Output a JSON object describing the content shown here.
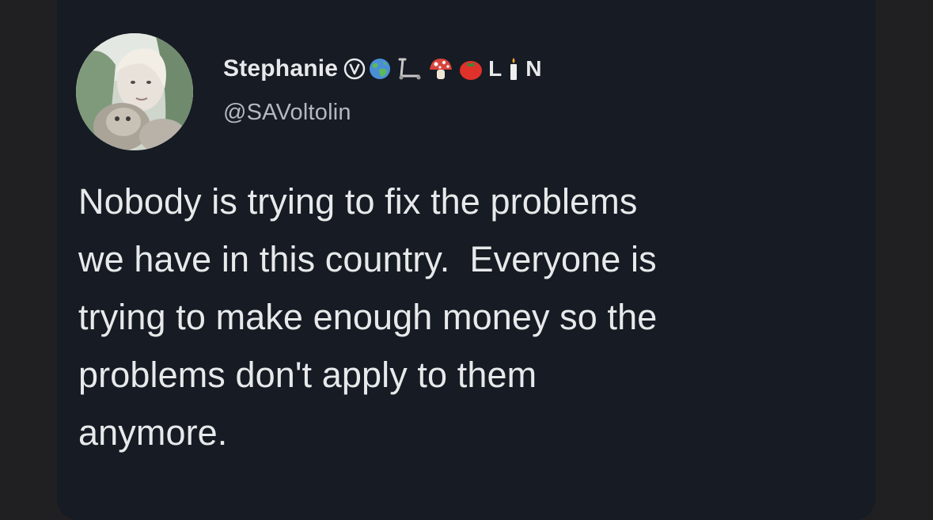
{
  "user": {
    "display_name": "Stephanie",
    "handle": "@SAVoltolin",
    "name_decorations": [
      {
        "type": "icon",
        "name": "v-circle-icon"
      },
      {
        "type": "icon",
        "name": "globe-icon"
      },
      {
        "type": "icon",
        "name": "scooter-icon"
      },
      {
        "type": "icon",
        "name": "mushroom-icon"
      },
      {
        "type": "icon",
        "name": "tomato-icon"
      },
      {
        "type": "text",
        "value": "L"
      },
      {
        "type": "icon",
        "name": "candle-icon"
      },
      {
        "type": "text",
        "value": "N"
      }
    ],
    "letters": {
      "l": "L",
      "n": "N"
    }
  },
  "tweet": {
    "lines": [
      "Nobody is trying to fix the problems",
      "we have in this country.  Everyone is",
      "trying to make enough money so the",
      "problems don't apply to them",
      "anymore."
    ]
  },
  "colors": {
    "card_background": "#161b24",
    "outer_background": "#202022",
    "primary_text": "#e7e9ea",
    "secondary_text": "#b4b9be"
  }
}
